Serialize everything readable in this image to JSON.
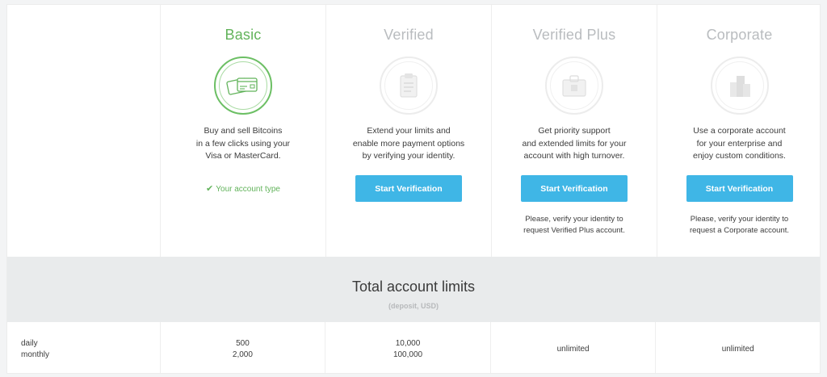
{
  "plans": [
    {
      "title": "Basic",
      "icon": "credit-cards-icon",
      "description": [
        "Buy and sell Bitcoins",
        "in a few clicks using your",
        "Visa or MasterCard."
      ],
      "status": "Your account type",
      "active": true
    },
    {
      "title": "Verified",
      "icon": "clipboard-icon",
      "description": [
        "Extend your limits and",
        "enable more payment options",
        "by verifying your identity."
      ],
      "button": "Start Verification"
    },
    {
      "title": "Verified Plus",
      "icon": "id-badge-icon",
      "description": [
        "Get priority support",
        "and extended limits for your",
        "account with high turnover."
      ],
      "button": "Start Verification",
      "note": [
        "Please, verify your identity to",
        "request Verified Plus account."
      ]
    },
    {
      "title": "Corporate",
      "icon": "buildings-icon",
      "description": [
        "Use a corporate account",
        "for your enterprise and",
        "enjoy custom conditions."
      ],
      "button": "Start Verification",
      "note": [
        "Please, verify your identity to",
        "request a Corporate account."
      ]
    }
  ],
  "limits": {
    "title": "Total account limits",
    "subtitle": "(deposit, USD)",
    "row_labels": [
      "daily",
      "monthly"
    ],
    "values": [
      [
        "500",
        "2,000"
      ],
      [
        "10,000",
        "100,000"
      ],
      [
        "unlimited"
      ],
      [
        "unlimited"
      ]
    ]
  },
  "colors": {
    "active_green": "#62b35b",
    "button_blue": "#3fb6e6",
    "inactive_title": "#b9bcbf"
  }
}
